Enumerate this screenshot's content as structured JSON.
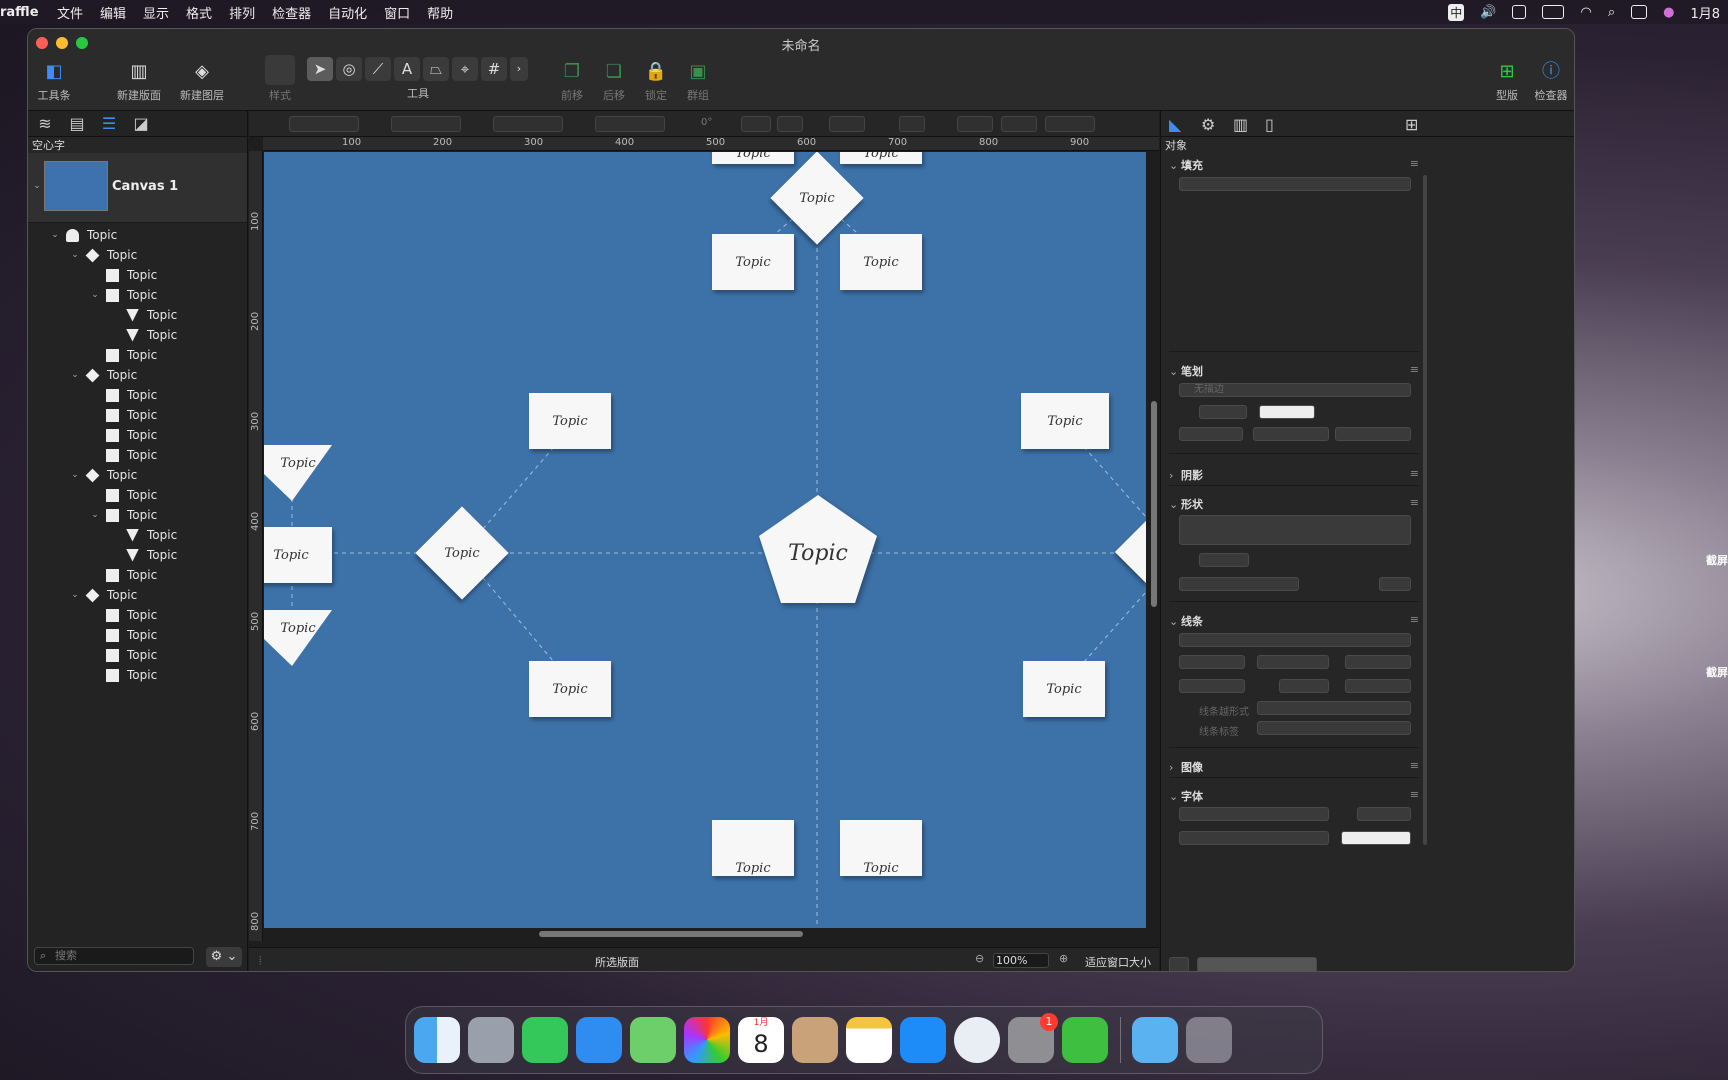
{
  "menubar": {
    "app": "raffle",
    "items": [
      "文件",
      "编辑",
      "显示",
      "格式",
      "排列",
      "检查器",
      "自动化",
      "窗口",
      "帮助"
    ],
    "clock": "1月8"
  },
  "window": {
    "title": "未命名",
    "toolbar": {
      "toolbox": "工具条",
      "new_canvas": "新建版面",
      "new_layer": "新建图层",
      "style": "样式",
      "tools": "工具",
      "forward": "前移",
      "backward": "后移",
      "lock": "锁定",
      "group": "群组",
      "stencils": "型版",
      "inspector": "检查器"
    }
  },
  "left_panel": {
    "header": "空心字",
    "canvas_name": "Canvas 1",
    "search_placeholder": "搜索",
    "tree": [
      {
        "level": 0,
        "icon": "pent",
        "label": "Topic",
        "open": true
      },
      {
        "level": 1,
        "icon": "dia",
        "label": "Topic",
        "open": true
      },
      {
        "level": 2,
        "icon": "sq",
        "label": "Topic"
      },
      {
        "level": 2,
        "icon": "sq",
        "label": "Topic",
        "open": true
      },
      {
        "level": 3,
        "icon": "tri",
        "label": "Topic"
      },
      {
        "level": 3,
        "icon": "tri",
        "label": "Topic"
      },
      {
        "level": 2,
        "icon": "sq",
        "label": "Topic"
      },
      {
        "level": 1,
        "icon": "dia",
        "label": "Topic",
        "open": true
      },
      {
        "level": 2,
        "icon": "sq",
        "label": "Topic"
      },
      {
        "level": 2,
        "icon": "sq",
        "label": "Topic"
      },
      {
        "level": 2,
        "icon": "sq",
        "label": "Topic"
      },
      {
        "level": 2,
        "icon": "sq",
        "label": "Topic"
      },
      {
        "level": 1,
        "icon": "dia",
        "label": "Topic",
        "open": true
      },
      {
        "level": 2,
        "icon": "sq",
        "label": "Topic"
      },
      {
        "level": 2,
        "icon": "sq",
        "label": "Topic",
        "open": true
      },
      {
        "level": 3,
        "icon": "tri",
        "label": "Topic"
      },
      {
        "level": 3,
        "icon": "tri",
        "label": "Topic"
      },
      {
        "level": 2,
        "icon": "sq",
        "label": "Topic"
      },
      {
        "level": 1,
        "icon": "dia",
        "label": "Topic",
        "open": true
      },
      {
        "level": 2,
        "icon": "sq",
        "label": "Topic"
      },
      {
        "level": 2,
        "icon": "sq",
        "label": "Topic"
      },
      {
        "level": 2,
        "icon": "sq",
        "label": "Topic"
      },
      {
        "level": 2,
        "icon": "sq",
        "label": "Topic"
      }
    ]
  },
  "options_bar": {
    "rotation": "0°"
  },
  "rulers": {
    "h": [
      "100",
      "200",
      "300",
      "400",
      "500",
      "600",
      "700",
      "800",
      "900"
    ],
    "v": [
      "100",
      "200",
      "300",
      "400",
      "500",
      "600",
      "700",
      "800"
    ]
  },
  "diagram": {
    "center_label": "Topic",
    "node_label": "Topic"
  },
  "status": {
    "center": "所选版面",
    "zoom": "100%",
    "fit": "适应窗口大小"
  },
  "inspector": {
    "header": "对象",
    "sections": {
      "fill": "填充",
      "stroke": "笔划",
      "stroke_placeholder": "无描边",
      "shadow": "阴影",
      "shape": "形状",
      "lines": "线条",
      "line_jump": "线条越形式",
      "line_label": "线条标签",
      "image": "图像",
      "font": "字体"
    }
  },
  "desktop": {
    "side_labels": [
      "截屏",
      "截屏"
    ]
  },
  "dock": {
    "calendar_month": "1月",
    "calendar_day": "8",
    "badge": "1"
  },
  "colors": {
    "canvas": "#3d72a9",
    "accent": "#3d8ef0",
    "green": "#2ecc40"
  }
}
